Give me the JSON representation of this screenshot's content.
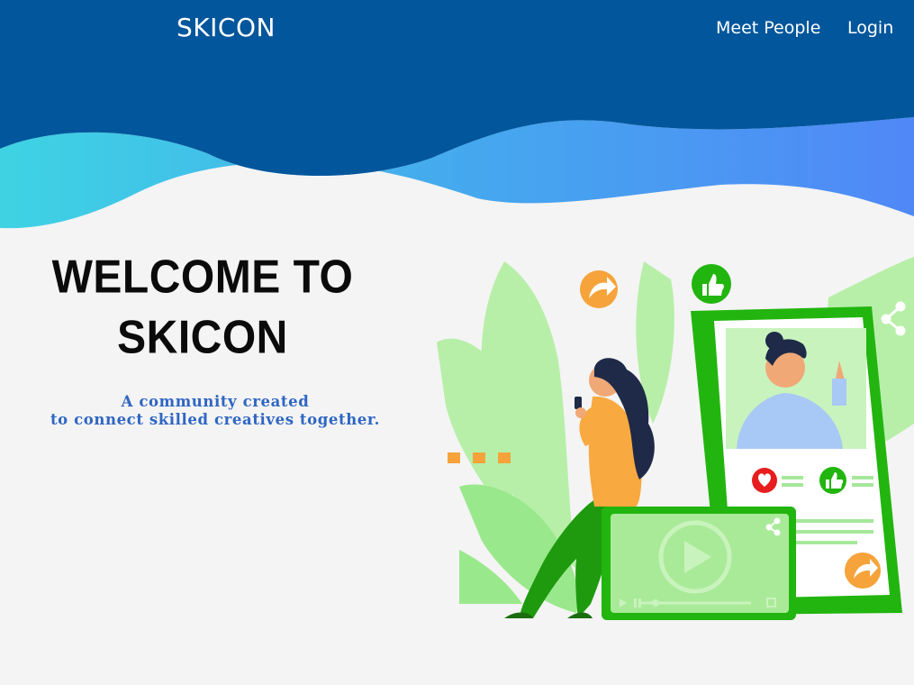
{
  "header": {
    "brand": "SKICON",
    "nav": {
      "meet_people": "Meet People",
      "login": "Login"
    }
  },
  "hero": {
    "title_line1": "WELCOME TO",
    "title_line2": "SKICON",
    "tagline_line1": "A community created",
    "tagline_line2": "to connect skilled creatives together."
  },
  "colors": {
    "header_blue": "#02569b",
    "wave_cyan": "#3ecfe2",
    "wave_blue": "#4d8ff5",
    "accent_green": "#22b50f",
    "accent_orange": "#f5a33a",
    "tagline_blue": "#2f66c3"
  },
  "illustration": {
    "icons": [
      "share-arrow-icon",
      "thumbs-up-icon",
      "share-icon",
      "heart-icon",
      "play-icon"
    ]
  }
}
